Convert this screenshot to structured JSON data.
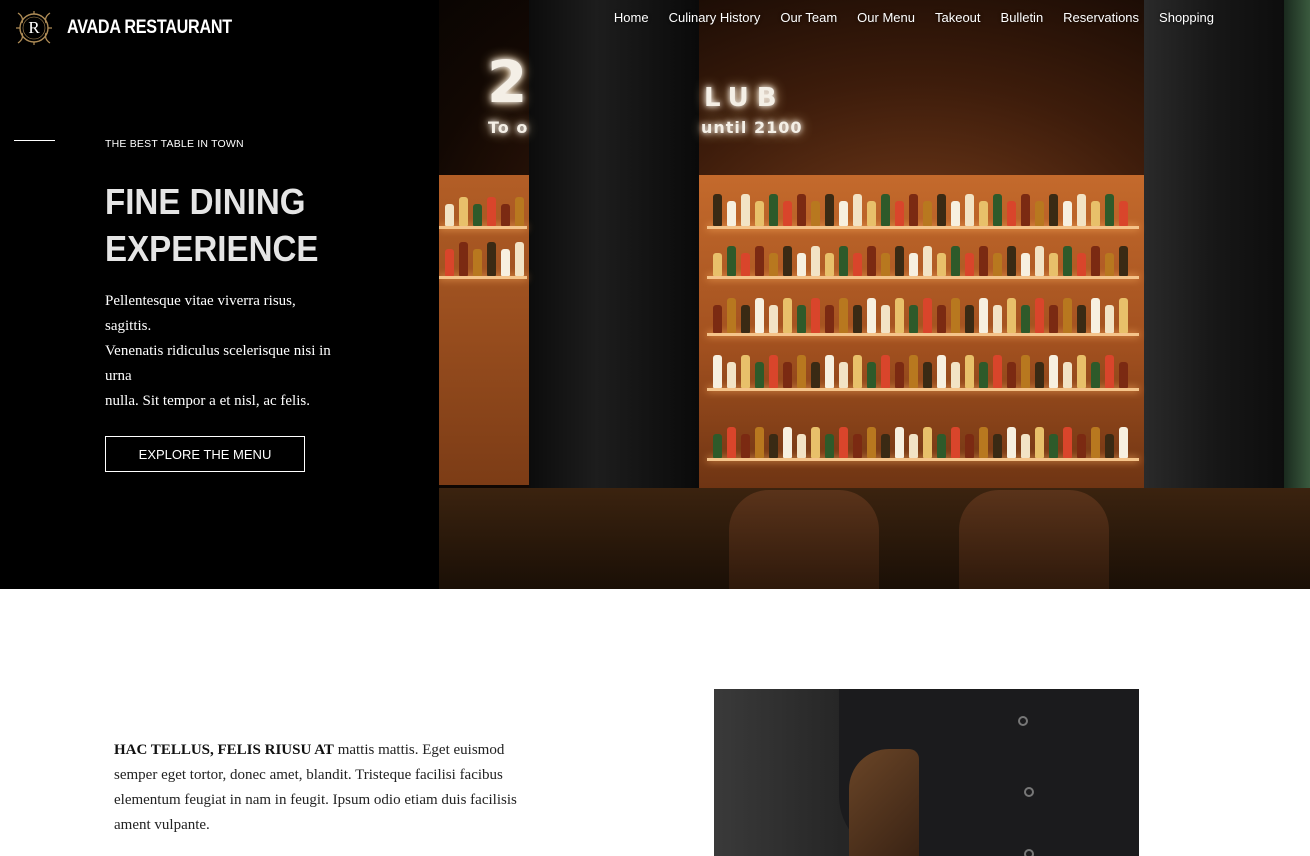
{
  "header": {
    "logo_letter": "R",
    "brand": "AVADA RESTAURANT",
    "nav": [
      "Home",
      "Culinary History",
      "Our Team",
      "Our Menu",
      "Takeout",
      "Bulletin",
      "Reservations",
      "Shopping"
    ]
  },
  "hero": {
    "eyebrow": "THE BEST TABLE IN TOWN",
    "title_line1": "FINE DINING",
    "title_line2": "EXPERIENCE",
    "text_line1": "Pellentesque vitae viverra risus, sagittis.",
    "text_line2": "Venenatis ridiculus scelerisque nisi in urna",
    "text_line3": "nulla. Sit tempor a et nisl, ac felis.",
    "button": "EXPLORE THE MENU",
    "neon_top": "2",
    "neon_club": "LUB",
    "neon_sub_left": "To o",
    "neon_sub_right": "until 2100"
  },
  "content": {
    "lead": "HAC TELLUS, FELIS RIUSU AT",
    "body": "mattis mattis. Eget euismod semper eget tortor, donec amet, blandit. Tristeque facilisi facibus elementum feugiat in nam in feugit. Ipsum odio etiam duis facilisis ament vulpante."
  },
  "colors": {
    "hero_bg": "#000000",
    "accent_gold": "#b08d57",
    "text_dark": "#222222"
  }
}
